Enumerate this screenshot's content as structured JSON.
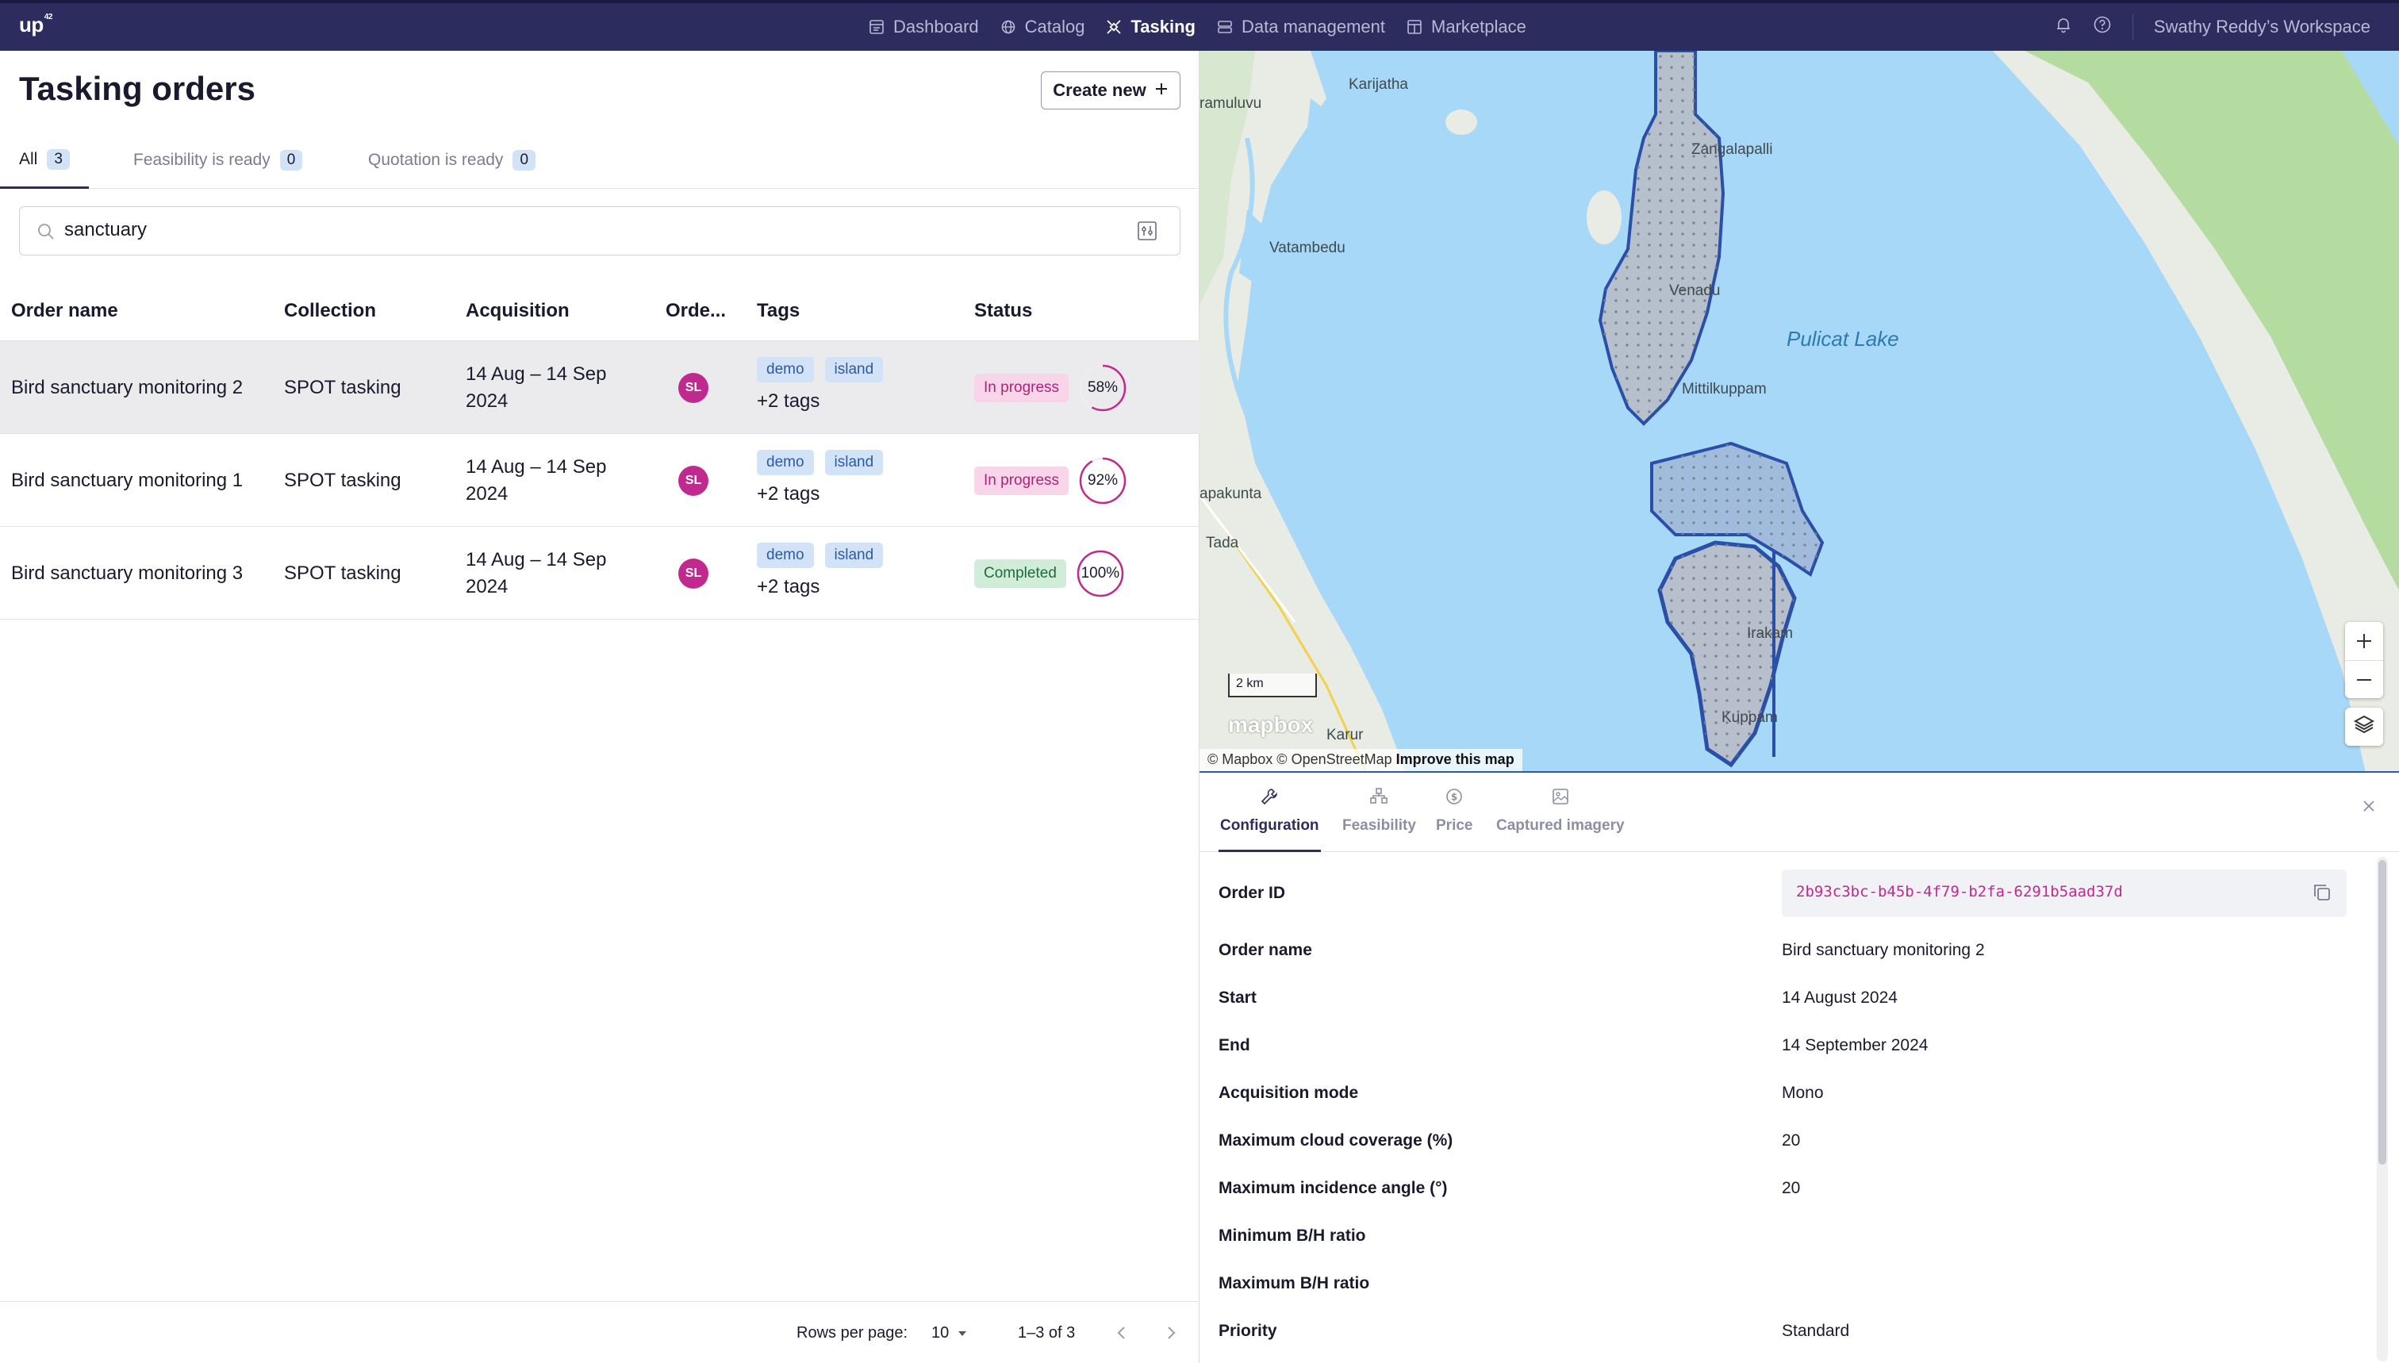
{
  "app": {
    "logo": "up",
    "logo_sup": "42"
  },
  "nav": {
    "items": [
      {
        "label": "Dashboard",
        "icon": "dashboard-icon"
      },
      {
        "label": "Catalog",
        "icon": "catalog-icon"
      },
      {
        "label": "Tasking",
        "icon": "tasking-icon",
        "active": true
      },
      {
        "label": "Data management",
        "icon": "storage-icon"
      },
      {
        "label": "Marketplace",
        "icon": "marketplace-icon"
      }
    ],
    "workspace": "Swathy Reddy’s Workspace"
  },
  "page": {
    "title": "Tasking orders",
    "create_label": "Create new"
  },
  "tabs": [
    {
      "label": "All",
      "count": "3",
      "active": true
    },
    {
      "label": "Feasibility is ready",
      "count": "0"
    },
    {
      "label": "Quotation is ready",
      "count": "0"
    }
  ],
  "search": {
    "value": "sanctuary"
  },
  "table": {
    "columns": [
      "Order name",
      "Collection",
      "Acquisition",
      "Orde...",
      "Tags",
      "Status"
    ],
    "rows": [
      {
        "name": "Bird sanctuary monitoring 2",
        "collection": "SPOT tasking",
        "acquisition": "14 Aug – 14 Sep 2024",
        "owner": "SL",
        "tags": [
          "demo",
          "island"
        ],
        "more_tags": "+2 tags",
        "status": "In progress",
        "progress_label": "58%",
        "progress": 0.58
      },
      {
        "name": "Bird sanctuary monitoring 1",
        "collection": "SPOT tasking",
        "acquisition": "14 Aug – 14 Sep 2024",
        "owner": "SL",
        "tags": [
          "demo",
          "island"
        ],
        "more_tags": "+2 tags",
        "status": "In progress",
        "progress_label": "92%",
        "progress": 0.92
      },
      {
        "name": "Bird sanctuary monitoring 3",
        "collection": "SPOT tasking",
        "acquisition": "14 Aug – 14 Sep 2024",
        "owner": "SL",
        "tags": [
          "demo",
          "island"
        ],
        "more_tags": "+2 tags",
        "status": "Completed",
        "progress_label": "100%",
        "progress": 1.0
      }
    ]
  },
  "footer": {
    "rows_per_page_label": "Rows per page:",
    "rows_per_page": "10",
    "range": "1–3 of 3"
  },
  "map": {
    "labels": {
      "karijatha": "Karijatha",
      "ramuluvu": "ramuluvu",
      "zangalapalli": "Zangalapalli",
      "vatambedu": "Vatambedu",
      "venadu": "Venadu",
      "pulicat": "Pulicat Lake",
      "mittilkuppam": "Mittilkuppam",
      "apakunta": "apakunta",
      "tada": "Tada",
      "irakam": "Irakam",
      "kuppam": "Kuppam",
      "karur": "Karur"
    },
    "scale": "2 km",
    "attribution": "© Mapbox © OpenStreetMap",
    "improve": "Improve this map",
    "mapbox_logo": "mapbox",
    "colors": {
      "water": "#a8d8f7",
      "land": "#e9ece4",
      "green": "#b4dba0",
      "aoi": "#2a4fa8"
    }
  },
  "details": {
    "tabs": [
      {
        "label": "Configuration",
        "icon": "wrench-icon",
        "active": true
      },
      {
        "label": "Feasibility",
        "icon": "feasibility-icon"
      },
      {
        "label": "Price",
        "icon": "price-icon"
      },
      {
        "label": "Captured imagery",
        "icon": "image-icon"
      }
    ],
    "order_id_label": "Order ID",
    "order_id": "2b93c3bc-b45b-4f79-b2fa-6291b5aad37d",
    "fields": [
      {
        "label": "Order name",
        "value": "Bird sanctuary monitoring 2"
      },
      {
        "label": "Start",
        "value": "14 August 2024"
      },
      {
        "label": "End",
        "value": "14 September 2024"
      },
      {
        "label": "Acquisition mode",
        "value": "Mono"
      },
      {
        "label": "Maximum cloud coverage (%)",
        "value": "20"
      },
      {
        "label": "Maximum incidence angle (°)",
        "value": "20"
      },
      {
        "label": "Minimum B/H ratio",
        "value": ""
      },
      {
        "label": "Maximum B/H ratio",
        "value": ""
      },
      {
        "label": "Priority",
        "value": "Standard"
      }
    ]
  }
}
